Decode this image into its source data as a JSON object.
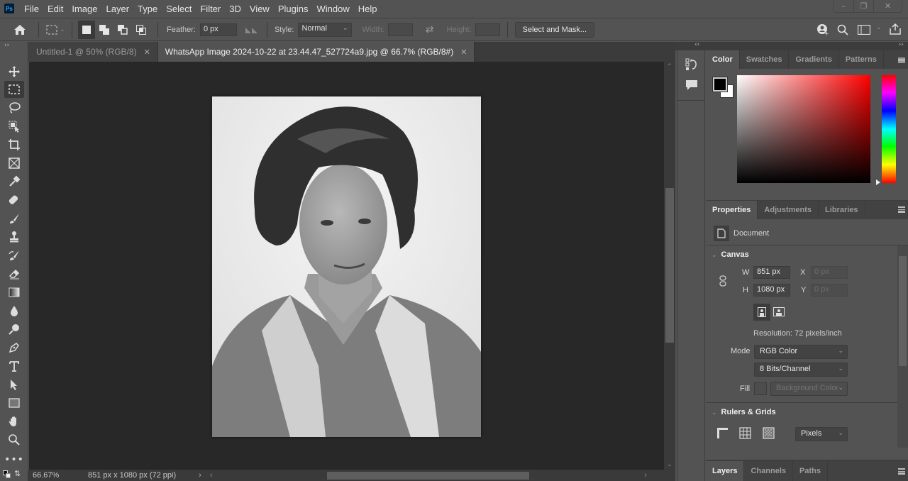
{
  "app": {
    "logo": "Ps"
  },
  "menu": [
    "File",
    "Edit",
    "Image",
    "Layer",
    "Type",
    "Select",
    "Filter",
    "3D",
    "View",
    "Plugins",
    "Window",
    "Help"
  ],
  "window_controls": {
    "minimize": "–",
    "restore": "❐",
    "close": "✕"
  },
  "options_bar": {
    "feather_label": "Feather:",
    "feather_value": "0 px",
    "style_label": "Style:",
    "style_value": "Normal",
    "width_label": "Width:",
    "height_label": "Height:",
    "select_mask_label": "Select and Mask..."
  },
  "tabs": [
    {
      "label": "Untitled-1 @ 50% (RGB/8)",
      "active": false
    },
    {
      "label": "WhatsApp Image 2024-10-22 at 23.44.47_527724a9.jpg @ 66.7% (RGB/8#)",
      "active": true
    }
  ],
  "tools": [
    "move",
    "rectangular-marquee",
    "lasso",
    "object-selection",
    "crop",
    "frame",
    "eyedropper",
    "healing-brush",
    "brush",
    "clone-stamp",
    "history-brush",
    "eraser",
    "gradient",
    "blur",
    "dodge",
    "pen",
    "type",
    "path-selection",
    "rectangle",
    "hand",
    "zoom",
    "more"
  ],
  "status": {
    "zoom": "66.67%",
    "doc_info": "851 px x 1080 px (72 ppi)"
  },
  "color_panel": {
    "tabs": [
      "Color",
      "Swatches",
      "Gradients",
      "Patterns"
    ],
    "active_tab": "Color",
    "foreground": "#000000",
    "background": "#ffffff",
    "hue_color": "#ff0000"
  },
  "properties_panel": {
    "tabs": [
      "Properties",
      "Adjustments",
      "Libraries"
    ],
    "active_tab": "Properties",
    "doc_label": "Document",
    "canvas_heading": "Canvas",
    "w_label": "W",
    "w_value": "851 px",
    "h_label": "H",
    "h_value": "1080 px",
    "x_label": "X",
    "x_value": "0 px",
    "y_label": "Y",
    "y_value": "0 px",
    "resolution": "Resolution: 72 pixels/inch",
    "mode_label": "Mode",
    "mode_value": "RGB Color",
    "bits_value": "8 Bits/Channel",
    "fill_label": "Fill",
    "fill_value": "Background Color",
    "rulers_heading": "Rulers & Grids",
    "units_value": "Pixels"
  },
  "layers_panel": {
    "tabs": [
      "Layers",
      "Channels",
      "Paths"
    ],
    "active_tab": "Layers"
  }
}
